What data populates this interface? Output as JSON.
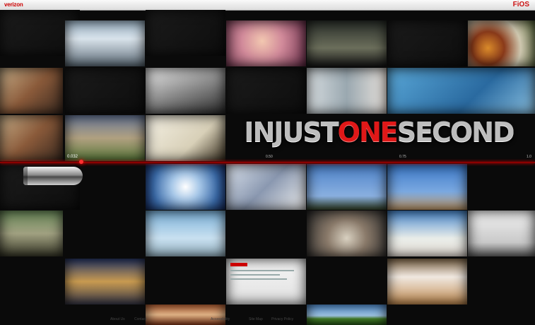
{
  "header": {
    "brand_logo": "verizon",
    "product_logo": "FiOS"
  },
  "headline": {
    "part1": "INJUST",
    "part2": "ONE",
    "part3": "SECOND"
  },
  "timeline": {
    "current": "0.032",
    "ticks": [
      "0.50",
      "0.75",
      "1.0"
    ],
    "progress": 0.032
  },
  "tiles": [
    {
      "name": "news-anchors-tile"
    },
    {
      "name": "woman-glasses-tile"
    },
    {
      "name": "dark-scene-tile"
    },
    {
      "name": "paint-bowls-tile"
    },
    {
      "name": "sports-fans-tile"
    },
    {
      "name": "sports-car-tile"
    },
    {
      "name": "woman-lamp-tile"
    },
    {
      "name": "surgery-tile"
    },
    {
      "name": "football-tile"
    },
    {
      "name": "pen-drawing-tile"
    },
    {
      "name": "hurricane-tile"
    },
    {
      "name": "engine-tile"
    },
    {
      "name": "rocket-pad-tile"
    },
    {
      "name": "space-shuttle-tile"
    },
    {
      "name": "street-dance-tile"
    },
    {
      "name": "jet-fighter-tile"
    },
    {
      "name": "water-splash-tile"
    },
    {
      "name": "launch-smoke-tile"
    },
    {
      "name": "white-car-tile"
    },
    {
      "name": "stage-concert-tile"
    },
    {
      "name": "website-tile"
    },
    {
      "name": "rocket-exhaust-tile"
    },
    {
      "name": "face-tile"
    },
    {
      "name": "field-tile"
    }
  ],
  "footer": {
    "links": [
      "About Us",
      "Contact",
      "Accessibility",
      "Site Map",
      "Privacy Policy"
    ]
  }
}
